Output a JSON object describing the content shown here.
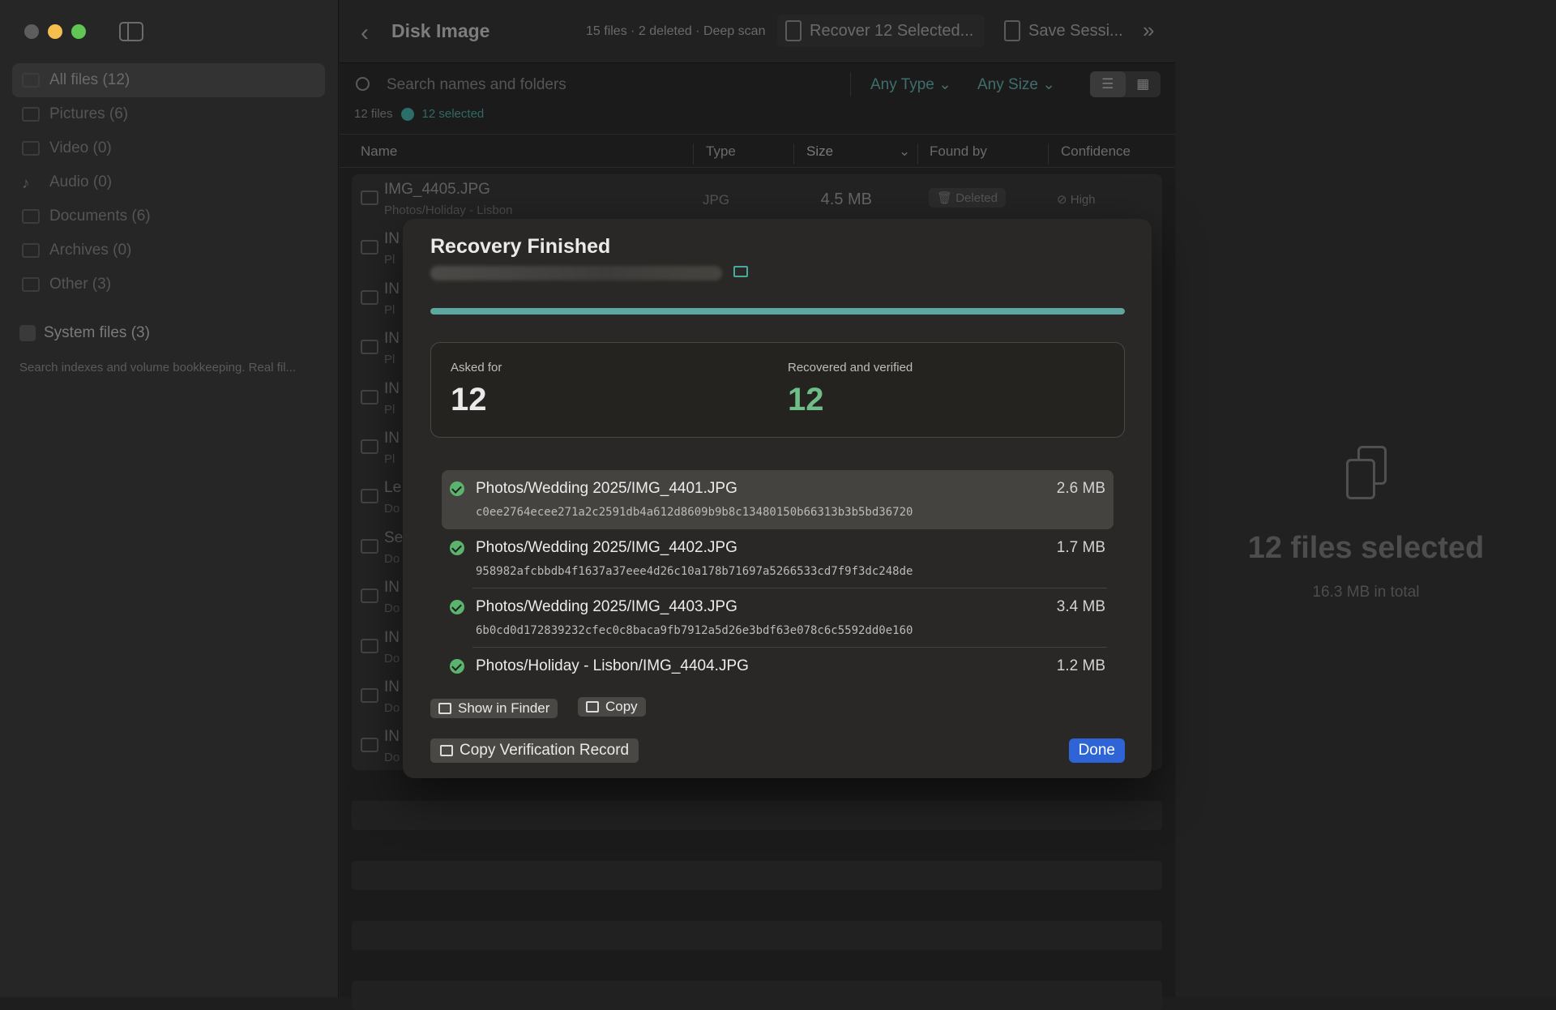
{
  "sidebar": {
    "items": [
      {
        "label": "All files (12)"
      },
      {
        "label": "Pictures (6)"
      },
      {
        "label": "Video (0)"
      },
      {
        "label": "Audio (0)"
      },
      {
        "label": "Documents (6)"
      },
      {
        "label": "Archives (0)"
      },
      {
        "label": "Other (3)"
      }
    ],
    "system_files": "System files (3)",
    "system_desc": "Search indexes and volume bookkeeping. Real fil..."
  },
  "toolbar": {
    "title": "Disk Image",
    "scan_info": "15 files · 2 deleted · Deep scan",
    "recover_label": "Recover 12 Selected...",
    "save_label": "Save Sessi..."
  },
  "search": {
    "placeholder": "Search names and folders",
    "type_filter": "Any Type",
    "size_filter": "Any Size"
  },
  "counts": {
    "files": "12 files",
    "selected": "12 selected"
  },
  "table": {
    "headers": {
      "name": "Name",
      "type": "Type",
      "size": "Size",
      "found_by": "Found by",
      "confidence": "Confidence"
    },
    "first_row": {
      "name": "IMG_4405.JPG",
      "path": "Photos/Holiday - Lisbon",
      "type": "JPG",
      "size": "4.5 MB",
      "found_by": "Deleted",
      "confidence": "High"
    },
    "rows": [
      {
        "name": "IN",
        "path": "Pl"
      },
      {
        "name": "IN",
        "path": "Pl"
      },
      {
        "name": "IN",
        "path": "Pl"
      },
      {
        "name": "IN",
        "path": "Pl"
      },
      {
        "name": "IN",
        "path": "Pl"
      },
      {
        "name": "Le",
        "path": "Do"
      },
      {
        "name": "Se",
        "path": "Do"
      },
      {
        "name": "IN",
        "path": "Do"
      },
      {
        "name": "IN",
        "path": "Do"
      },
      {
        "name": "IN",
        "path": "Do"
      },
      {
        "name": "IN",
        "path": "Do"
      }
    ]
  },
  "right_panel": {
    "title": "12 files selected",
    "subtitle": "16.3 MB in total"
  },
  "modal": {
    "title": "Recovery Finished",
    "progress": 1.0,
    "asked_label": "Asked for",
    "asked_value": "12",
    "verified_label": "Recovered and verified",
    "verified_value": "12",
    "files": [
      {
        "path": "Photos/Wedding 2025/IMG_4401.JPG",
        "hash": "c0ee2764ecee271a2c2591db4a612d8609b9b8c13480150b66313b3b5bd36720",
        "size": "2.6 MB"
      },
      {
        "path": "Photos/Wedding 2025/IMG_4402.JPG",
        "hash": "958982afcbbdb4f1637a37eee4d26c10a178b71697a5266533cd7f9f3dc248de",
        "size": "1.7 MB"
      },
      {
        "path": "Photos/Wedding 2025/IMG_4403.JPG",
        "hash": "6b0cd0d172839232cfec0c8baca9fb7912a5d26e3bdf63e078c6c5592dd0e160",
        "size": "3.4 MB"
      },
      {
        "path": "Photos/Holiday - Lisbon/IMG_4404.JPG",
        "hash": "",
        "size": "1.2 MB"
      }
    ],
    "show_in_finder": "Show in Finder",
    "copy": "Copy",
    "copy_record": "Copy Verification Record",
    "done": "Done"
  },
  "colors": {
    "accent_teal": "#5fa6a1",
    "success_green": "#6fbe88",
    "primary_blue": "#2f64d6"
  }
}
